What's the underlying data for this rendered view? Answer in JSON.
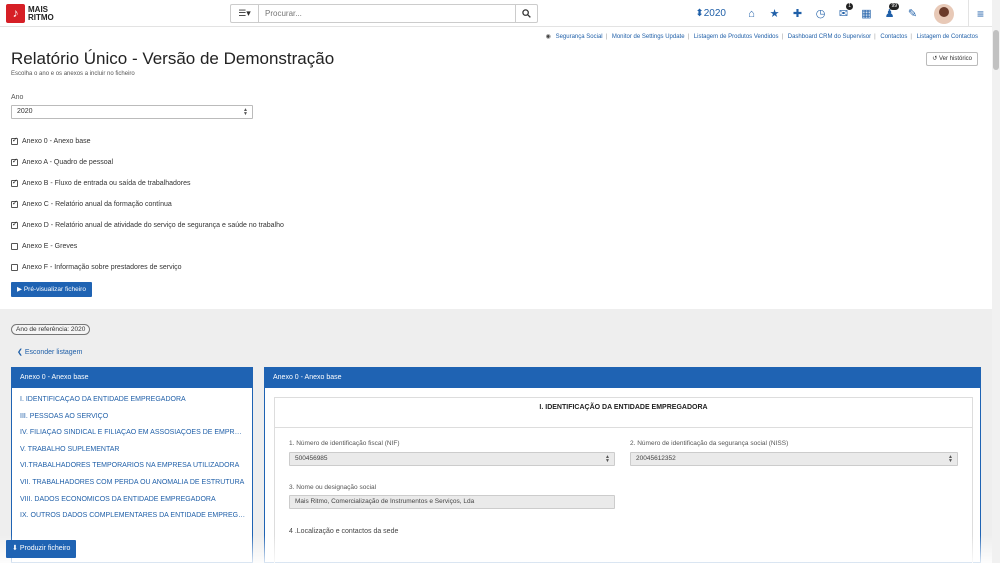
{
  "brand": {
    "logo_text_line1": "MAIS",
    "logo_text_line2": "RITMO",
    "accent": "#1f63b3",
    "logo_color": "#d61f26"
  },
  "search": {
    "placeholder": "Procurar..."
  },
  "nav": {
    "year": "2020",
    "messages_badge": "1",
    "notifications_badge": "99"
  },
  "toplinks": [
    "Segurança Social",
    "Monitor de Settings Update",
    "Listagem de Produtos Vendidos",
    "Dashboard CRM do Supervisor",
    "Contactos",
    "Listagem de Contactos"
  ],
  "page": {
    "title": "Relatório Único - Versão de Demonstração",
    "subtitle": "Escolha o ano e os anexos a incluir no ficheiro",
    "history_button": "Ver histórico",
    "year_label": "Ano",
    "year_value": "2020",
    "preview_button": "Pré-visualizar ficheiro",
    "reference_pill": "Ano de referência: 2020",
    "hide_link": "Esconder listagem",
    "produce_button": "Produzir ficheiro"
  },
  "annexes": [
    {
      "label": "Anexo 0 - Anexo base",
      "checked": true
    },
    {
      "label": "Anexo A - Quadro de pessoal",
      "checked": true
    },
    {
      "label": "Anexo B - Fluxo de entrada ou saída de trabalhadores",
      "checked": true
    },
    {
      "label": "Anexo C - Relatório anual da formação contínua",
      "checked": true
    },
    {
      "label": "Anexo D - Relatório anual de atividade do serviço de segurança e saúde no trabalho",
      "checked": true
    },
    {
      "label": "Anexo E - Greves",
      "checked": false
    },
    {
      "label": "Anexo F - Informação sobre prestadores de serviço",
      "checked": false
    }
  ],
  "left_panel": {
    "header": "Anexo 0 - Anexo base",
    "sections": [
      "I. IDENTIFICAÇÃO DA ENTIDADE EMPREGADORA",
      "III. PESSOAS AO SERVIÇO",
      "IV. FILIAÇÃO SINDICAL E FILIAÇÃO EM ASSOSIAÇÕES DE EMPREGADORES",
      "V. TRABALHO SUPLEMENTAR",
      "VI.TRABALHADORES TEMPORÁRIOS NA EMPRESA UTILIZADORA",
      "VII. TRABALHADORES COM PERDA OU ANOMALIA DE ESTRUTURA",
      "VIII. DADOS ECONÓMICOS DA ENTIDADE EMPREGADORA",
      "IX. OUTROS DADOS COMPLEMENTARES DA ENTIDADE EMPREGADORA"
    ]
  },
  "right_panel": {
    "header": "Anexo 0 - Anexo base",
    "section_title": "I. IDENTIFICAÇÃO DA ENTIDADE EMPREGADORA",
    "nif_label": "1. Número de identificação fiscal (NIF)",
    "nif_value": "500456985",
    "niss_label": "2. Número de identificação da segurança social (NISS)",
    "niss_value": "20045612352",
    "name_label": "3. Nome ou designação social",
    "name_value": "Mais Ritmo, Comercialização de Instrumentos e Serviços, Lda",
    "location_label": "4 .Localização e contactos da sede"
  }
}
